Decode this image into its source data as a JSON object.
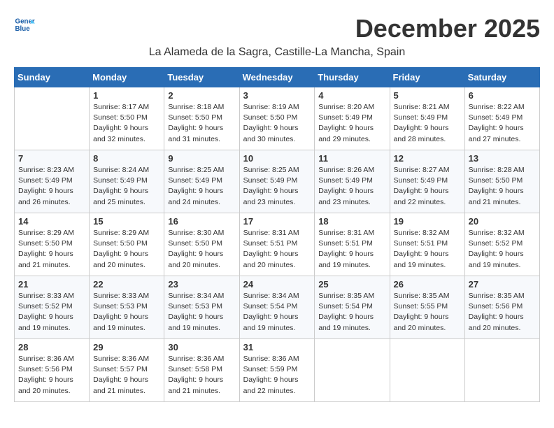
{
  "header": {
    "logo_line1": "General",
    "logo_line2": "Blue",
    "month": "December 2025",
    "location": "La Alameda de la Sagra, Castille-La Mancha, Spain"
  },
  "weekdays": [
    "Sunday",
    "Monday",
    "Tuesday",
    "Wednesday",
    "Thursday",
    "Friday",
    "Saturday"
  ],
  "weeks": [
    [
      {
        "day": "",
        "info": ""
      },
      {
        "day": "1",
        "info": "Sunrise: 8:17 AM\nSunset: 5:50 PM\nDaylight: 9 hours\nand 32 minutes."
      },
      {
        "day": "2",
        "info": "Sunrise: 8:18 AM\nSunset: 5:50 PM\nDaylight: 9 hours\nand 31 minutes."
      },
      {
        "day": "3",
        "info": "Sunrise: 8:19 AM\nSunset: 5:50 PM\nDaylight: 9 hours\nand 30 minutes."
      },
      {
        "day": "4",
        "info": "Sunrise: 8:20 AM\nSunset: 5:49 PM\nDaylight: 9 hours\nand 29 minutes."
      },
      {
        "day": "5",
        "info": "Sunrise: 8:21 AM\nSunset: 5:49 PM\nDaylight: 9 hours\nand 28 minutes."
      },
      {
        "day": "6",
        "info": "Sunrise: 8:22 AM\nSunset: 5:49 PM\nDaylight: 9 hours\nand 27 minutes."
      }
    ],
    [
      {
        "day": "7",
        "info": "Sunrise: 8:23 AM\nSunset: 5:49 PM\nDaylight: 9 hours\nand 26 minutes."
      },
      {
        "day": "8",
        "info": "Sunrise: 8:24 AM\nSunset: 5:49 PM\nDaylight: 9 hours\nand 25 minutes."
      },
      {
        "day": "9",
        "info": "Sunrise: 8:25 AM\nSunset: 5:49 PM\nDaylight: 9 hours\nand 24 minutes."
      },
      {
        "day": "10",
        "info": "Sunrise: 8:25 AM\nSunset: 5:49 PM\nDaylight: 9 hours\nand 23 minutes."
      },
      {
        "day": "11",
        "info": "Sunrise: 8:26 AM\nSunset: 5:49 PM\nDaylight: 9 hours\nand 23 minutes."
      },
      {
        "day": "12",
        "info": "Sunrise: 8:27 AM\nSunset: 5:49 PM\nDaylight: 9 hours\nand 22 minutes."
      },
      {
        "day": "13",
        "info": "Sunrise: 8:28 AM\nSunset: 5:50 PM\nDaylight: 9 hours\nand 21 minutes."
      }
    ],
    [
      {
        "day": "14",
        "info": "Sunrise: 8:29 AM\nSunset: 5:50 PM\nDaylight: 9 hours\nand 21 minutes."
      },
      {
        "day": "15",
        "info": "Sunrise: 8:29 AM\nSunset: 5:50 PM\nDaylight: 9 hours\nand 20 minutes."
      },
      {
        "day": "16",
        "info": "Sunrise: 8:30 AM\nSunset: 5:50 PM\nDaylight: 9 hours\nand 20 minutes."
      },
      {
        "day": "17",
        "info": "Sunrise: 8:31 AM\nSunset: 5:51 PM\nDaylight: 9 hours\nand 20 minutes."
      },
      {
        "day": "18",
        "info": "Sunrise: 8:31 AM\nSunset: 5:51 PM\nDaylight: 9 hours\nand 19 minutes."
      },
      {
        "day": "19",
        "info": "Sunrise: 8:32 AM\nSunset: 5:51 PM\nDaylight: 9 hours\nand 19 minutes."
      },
      {
        "day": "20",
        "info": "Sunrise: 8:32 AM\nSunset: 5:52 PM\nDaylight: 9 hours\nand 19 minutes."
      }
    ],
    [
      {
        "day": "21",
        "info": "Sunrise: 8:33 AM\nSunset: 5:52 PM\nDaylight: 9 hours\nand 19 minutes."
      },
      {
        "day": "22",
        "info": "Sunrise: 8:33 AM\nSunset: 5:53 PM\nDaylight: 9 hours\nand 19 minutes."
      },
      {
        "day": "23",
        "info": "Sunrise: 8:34 AM\nSunset: 5:53 PM\nDaylight: 9 hours\nand 19 minutes."
      },
      {
        "day": "24",
        "info": "Sunrise: 8:34 AM\nSunset: 5:54 PM\nDaylight: 9 hours\nand 19 minutes."
      },
      {
        "day": "25",
        "info": "Sunrise: 8:35 AM\nSunset: 5:54 PM\nDaylight: 9 hours\nand 19 minutes."
      },
      {
        "day": "26",
        "info": "Sunrise: 8:35 AM\nSunset: 5:55 PM\nDaylight: 9 hours\nand 20 minutes."
      },
      {
        "day": "27",
        "info": "Sunrise: 8:35 AM\nSunset: 5:56 PM\nDaylight: 9 hours\nand 20 minutes."
      }
    ],
    [
      {
        "day": "28",
        "info": "Sunrise: 8:36 AM\nSunset: 5:56 PM\nDaylight: 9 hours\nand 20 minutes."
      },
      {
        "day": "29",
        "info": "Sunrise: 8:36 AM\nSunset: 5:57 PM\nDaylight: 9 hours\nand 21 minutes."
      },
      {
        "day": "30",
        "info": "Sunrise: 8:36 AM\nSunset: 5:58 PM\nDaylight: 9 hours\nand 21 minutes."
      },
      {
        "day": "31",
        "info": "Sunrise: 8:36 AM\nSunset: 5:59 PM\nDaylight: 9 hours\nand 22 minutes."
      },
      {
        "day": "",
        "info": ""
      },
      {
        "day": "",
        "info": ""
      },
      {
        "day": "",
        "info": ""
      }
    ]
  ]
}
